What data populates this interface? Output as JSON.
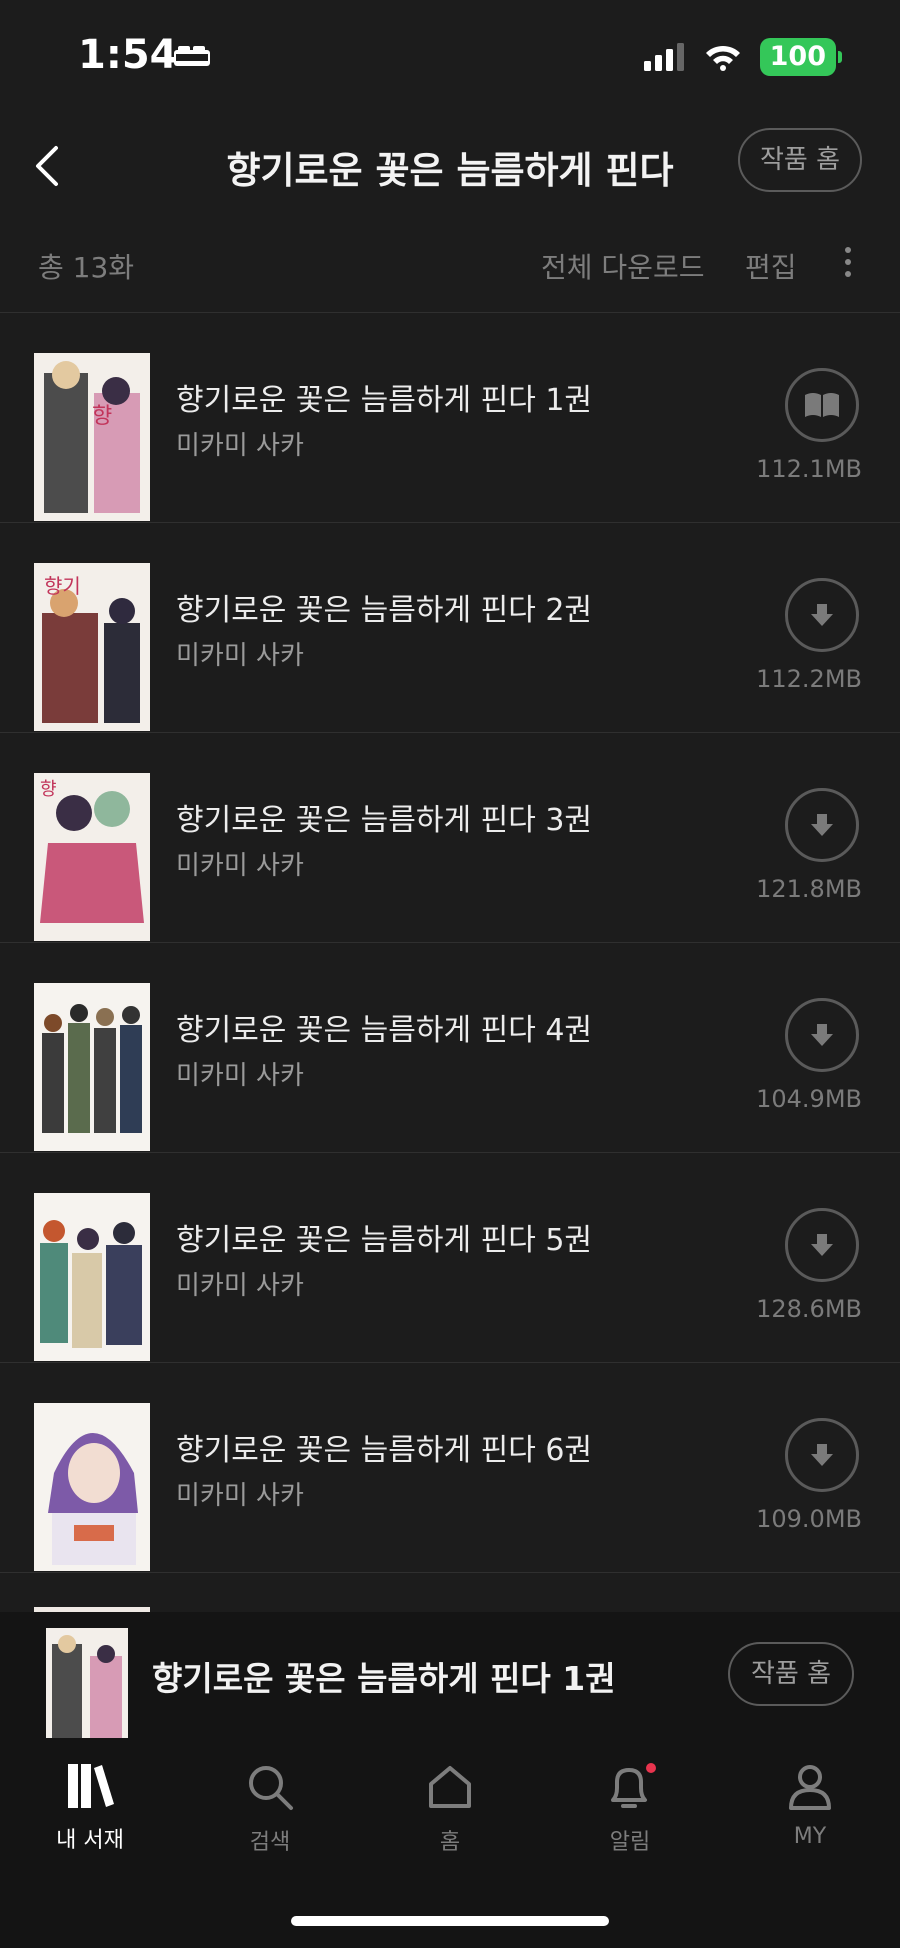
{
  "status": {
    "time": "1:54",
    "battery": "100"
  },
  "header": {
    "title": "향기로운 꽃은 늠름하게 핀다",
    "work_home": "작품 홈"
  },
  "subbar": {
    "count": "총 13화",
    "download_all": "전체 다운로드",
    "edit": "편집"
  },
  "items": [
    {
      "title": "향기로운 꽃은 늠름하게 핀다 1권",
      "author": "미카미 사카",
      "size": "112.1MB",
      "action_icon": "book-open-icon"
    },
    {
      "title": "향기로운 꽃은 늠름하게 핀다 2권",
      "author": "미카미 사카",
      "size": "112.2MB",
      "action_icon": "download-icon"
    },
    {
      "title": "향기로운 꽃은 늠름하게 핀다 3권",
      "author": "미카미 사카",
      "size": "121.8MB",
      "action_icon": "download-icon"
    },
    {
      "title": "향기로운 꽃은 늠름하게 핀다 4권",
      "author": "미카미 사카",
      "size": "104.9MB",
      "action_icon": "download-icon"
    },
    {
      "title": "향기로운 꽃은 늠름하게 핀다 5권",
      "author": "미카미 사카",
      "size": "128.6MB",
      "action_icon": "download-icon"
    },
    {
      "title": "향기로운 꽃은 늠름하게 핀다 6권",
      "author": "미카미 사카",
      "size": "109.0MB",
      "action_icon": "download-icon"
    }
  ],
  "mini_player": {
    "title": "향기로운 꽃은 늠름하게 핀다 1권",
    "work_home": "작품 홈"
  },
  "tabs": [
    {
      "label": "내 서재",
      "icon": "library-icon",
      "active": true
    },
    {
      "label": "검색",
      "icon": "search-icon",
      "active": false
    },
    {
      "label": "홈",
      "icon": "home-icon",
      "active": false
    },
    {
      "label": "알림",
      "icon": "bell-icon",
      "active": false
    },
    {
      "label": "MY",
      "icon": "person-icon",
      "active": false
    }
  ],
  "colors": {
    "background": "#1c1c1c",
    "battery": "#34c759",
    "notification_dot": "#e8344e"
  }
}
